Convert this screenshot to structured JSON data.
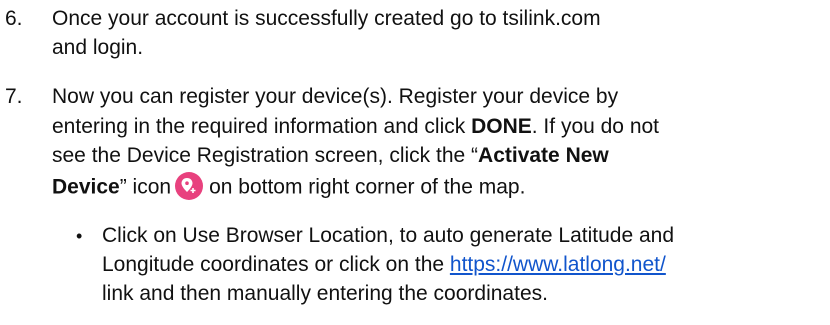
{
  "step6": {
    "number": "6.",
    "line1": "Once your account is successfully created go to tsilink.com",
    "line2": "and login."
  },
  "step7": {
    "number": "7.",
    "line1": "Now you can register your device(s). Register your device by",
    "line2_pre": "entering in the required information and click ",
    "done": "DONE",
    "line2_post": ". If you do not",
    "line3_pre": "see the Device Registration screen, click the “",
    "activate_new": "Activate New",
    "device": "Device",
    "line4_mid": "” icon",
    "line4_post": "on bottom right corner of the map."
  },
  "bullet": {
    "symbol": "•",
    "line1": "Click on Use Browser Location, to auto generate Latitude and",
    "line2_pre": "Longitude coordinates or click on the ",
    "link": "https://www.latlong.net/",
    "line3": "link and then manually entering the coordinates."
  },
  "colors": {
    "pin_icon": "#e8417e",
    "link": "#1155cc"
  },
  "icon": "location-pin-add-icon"
}
